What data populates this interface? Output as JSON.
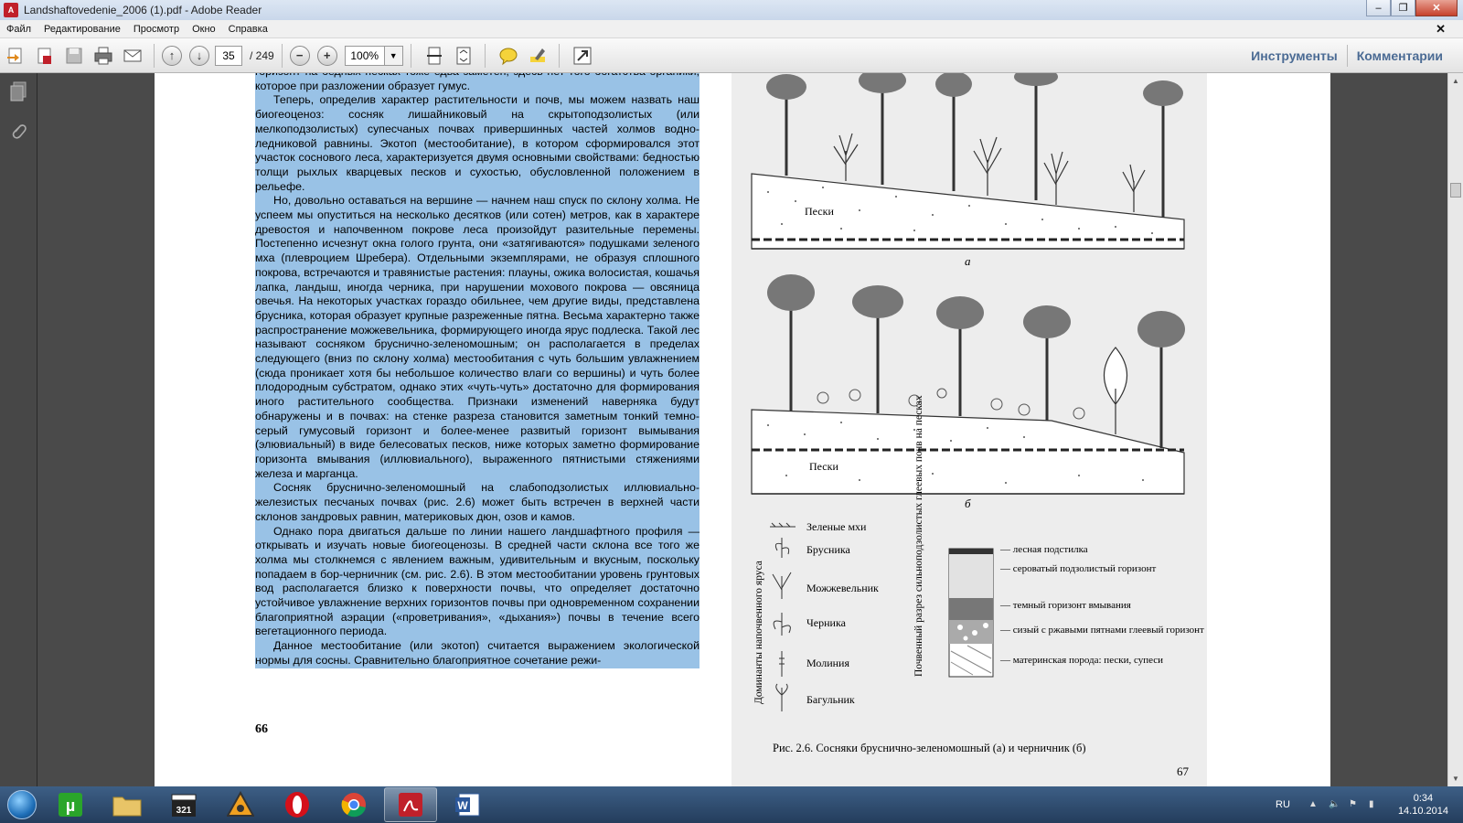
{
  "window": {
    "title": "Landshaftovedenie_2006 (1).pdf - Adobe Reader"
  },
  "menu": [
    "Файл",
    "Редактирование",
    "Просмотр",
    "Окно",
    "Справка"
  ],
  "toolbar": {
    "page_current": "35",
    "page_total": "/ 249",
    "zoom": "100%",
    "tools_label": "Инструменты",
    "comments_label": "Комментарии"
  },
  "document": {
    "paragraphs": [
      "горизонт на бедных песках тоже едва заметен, здесь нет того богатства органики, которое при разложении образует гумус.",
      "Теперь, определив характер растительности и почв, мы можем назвать наш биогеоценоз: сосняк лишайниковый на скрытоподзолистых (или мелкоподзолистых) супесчаных почвах привершинных частей холмов водно-ледниковой равнины. Экотоп (местообитание), в котором сформировался этот участок соснового леса, характеризуется двумя основными свойствами: бедностью толщи рыхлых кварцевых песков и сухостью, обусловленной положением в рельефе.",
      "Но, довольно оставаться на вершине — начнем наш спуск по склону холма. Не успеем мы опуститься на несколько десятков (или сотен) метров, как в характере древостоя и напочвенном покрове леса произойдут разительные перемены. Постепенно исчезнут окна голого грунта, они «затягиваются» подушками зеленого мха (плевроцием Шребера). Отдельными экземплярами, не образуя сплошного покрова, встречаются и травянистые растения: плауны, ожика волосистая, кошачья лапка, ландыш, иногда черника, при нарушении мохового покрова — овсяница овечья. На некоторых участках гораздо обильнее, чем другие виды, представлена брусника, которая образует крупные разреженные пятна. Весьма характерно также распространение можжевельника, формирующего иногда ярус подлеска. Такой лес называют сосняком брусничнo-зеленомошным; он располагается в пределах следующего (вниз по склону холма) местообитания с чуть большим увлажнением (сюда проникает хотя бы небольшое количество влаги со вершины) и чуть более плодородным субстратом, однако этих «чуть-чуть» достаточно для формирования иного растительного сообщества. Признаки изменений наверняка будут обнаружены и в почвах: на стенке разреза становится заметным тонкий темно-серый гумусовый горизонт и более-менее развитый горизонт вымывания (элювиальный) в виде белесоватых песков, ниже которых заметно формирование горизонта вмывания (иллювиального), выраженного пятнистыми стяжениями железа и марганца.",
      "Сосняк брусничнo-зеленомошный на слабоподзолистых иллювиально-железистых песчаных почвах (рис. 2.6) может быть встречен в верхней части склонов зандровых равнин, материковых дюн, озов и камов.",
      "Однако пора двигаться дальше по линии нашего ландшафтного профиля — открывать и изучать новые биогеоценозы. В средней части склона все того же холма мы столкнемся с явлением важным, удивительным и вкусным, поскольку попадаем в бор-черничник (см. рис. 2.6). В этом местообитании уровень грунтовых вод располагается близко к поверхности почвы, что определяет достаточно устойчивое увлажнение верхних горизонтов почвы при одновременном сохранении благоприятной аэрации («проветривания», «дыхания») почвы в течение всего вегетационного периода.",
      "Данное местообитание (или экотоп) считается выражением экологической нормы для сосны. Сравнительно благоприятное сочетание режи-"
    ],
    "page_number_left": "66",
    "figure": {
      "label_a": "а",
      "label_b": "б",
      "sand_label": "Пески",
      "legend_title_left": "Доминанты напочвенного яруса",
      "legend_plants": [
        "Зеленые мхи",
        "Брусника",
        "Можжевельник",
        "Черника",
        "Молиния",
        "Багульник"
      ],
      "legend_title_right": "Почвенный разрез сильноподзолистых глеевых почв на песках",
      "legend_soil": [
        "— лесная подстилка",
        "— сероватый подзолистый горизонт",
        "— темный горизонт вмывания",
        "— сизый с ржавыми пятнами глеевый горизонт",
        "— материнская порода: пески, супеси"
      ],
      "caption": "Рис. 2.6. Сосняки брусничнo-зеленомошный (а) и черничник (б)",
      "page_number_right": "67"
    }
  },
  "taskbar": {
    "lang": "RU",
    "time": "0:34",
    "date": "14.10.2014"
  }
}
